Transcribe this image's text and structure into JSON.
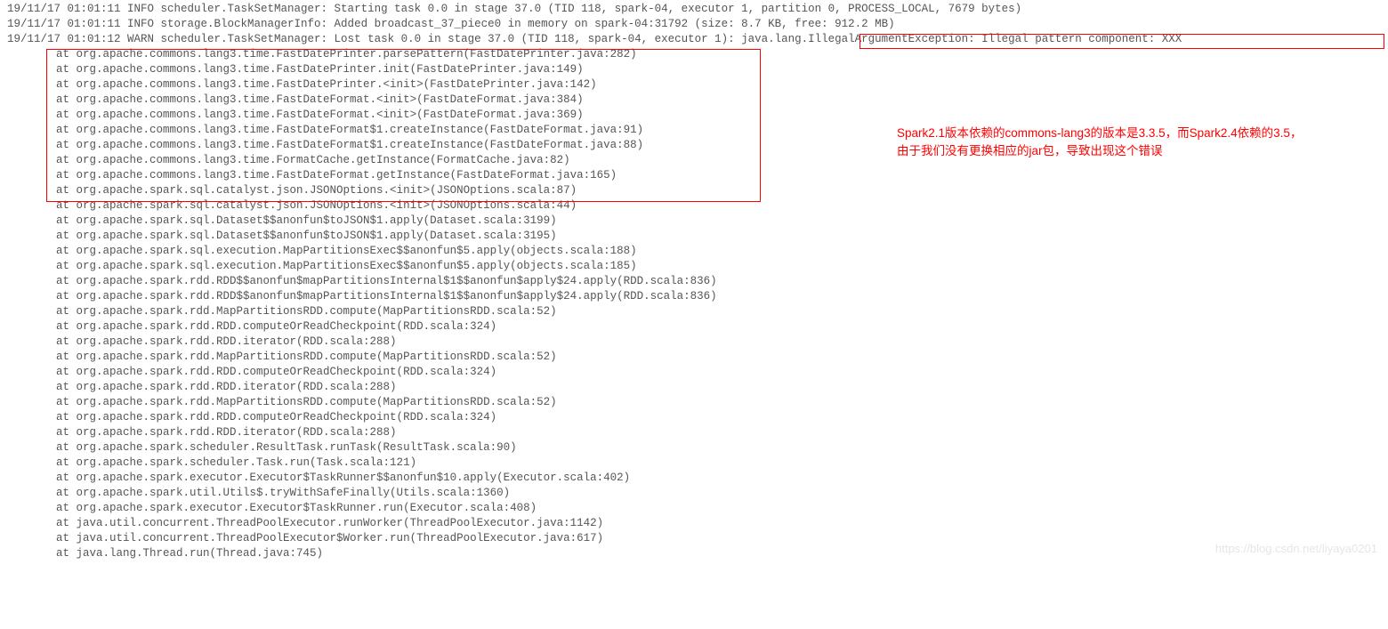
{
  "log": {
    "lines": [
      "19/11/17 01:01:11 INFO scheduler.TaskSetManager: Starting task 0.0 in stage 37.0 (TID 118, spark-04, executor 1, partition 0, PROCESS_LOCAL, 7679 bytes)",
      "19/11/17 01:01:11 INFO storage.BlockManagerInfo: Added broadcast_37_piece0 in memory on spark-04:31792 (size: 8.7 KB, free: 912.2 MB)",
      "19/11/17 01:01:12 WARN scheduler.TaskSetManager: Lost task 0.0 in stage 37.0 (TID 118, spark-04, executor 1): java.lang.IllegalArgumentException: Illegal pattern component: XXX"
    ]
  },
  "trace": {
    "lines": [
      "at org.apache.commons.lang3.time.FastDatePrinter.parsePattern(FastDatePrinter.java:282)",
      "at org.apache.commons.lang3.time.FastDatePrinter.init(FastDatePrinter.java:149)",
      "at org.apache.commons.lang3.time.FastDatePrinter.<init>(FastDatePrinter.java:142)",
      "at org.apache.commons.lang3.time.FastDateFormat.<init>(FastDateFormat.java:384)",
      "at org.apache.commons.lang3.time.FastDateFormat.<init>(FastDateFormat.java:369)",
      "at org.apache.commons.lang3.time.FastDateFormat$1.createInstance(FastDateFormat.java:91)",
      "at org.apache.commons.lang3.time.FastDateFormat$1.createInstance(FastDateFormat.java:88)",
      "at org.apache.commons.lang3.time.FormatCache.getInstance(FormatCache.java:82)",
      "at org.apache.commons.lang3.time.FastDateFormat.getInstance(FastDateFormat.java:165)",
      "at org.apache.spark.sql.catalyst.json.JSONOptions.<init>(JSONOptions.scala:87)",
      "at org.apache.spark.sql.catalyst.json.JSONOptions.<init>(JSONOptions.scala:44)",
      "at org.apache.spark.sql.Dataset$$anonfun$toJSON$1.apply(Dataset.scala:3199)",
      "at org.apache.spark.sql.Dataset$$anonfun$toJSON$1.apply(Dataset.scala:3195)",
      "at org.apache.spark.sql.execution.MapPartitionsExec$$anonfun$5.apply(objects.scala:188)",
      "at org.apache.spark.sql.execution.MapPartitionsExec$$anonfun$5.apply(objects.scala:185)",
      "at org.apache.spark.rdd.RDD$$anonfun$mapPartitionsInternal$1$$anonfun$apply$24.apply(RDD.scala:836)",
      "at org.apache.spark.rdd.RDD$$anonfun$mapPartitionsInternal$1$$anonfun$apply$24.apply(RDD.scala:836)",
      "at org.apache.spark.rdd.MapPartitionsRDD.compute(MapPartitionsRDD.scala:52)",
      "at org.apache.spark.rdd.RDD.computeOrReadCheckpoint(RDD.scala:324)",
      "at org.apache.spark.rdd.RDD.iterator(RDD.scala:288)",
      "at org.apache.spark.rdd.MapPartitionsRDD.compute(MapPartitionsRDD.scala:52)",
      "at org.apache.spark.rdd.RDD.computeOrReadCheckpoint(RDD.scala:324)",
      "at org.apache.spark.rdd.RDD.iterator(RDD.scala:288)",
      "at org.apache.spark.rdd.MapPartitionsRDD.compute(MapPartitionsRDD.scala:52)",
      "at org.apache.spark.rdd.RDD.computeOrReadCheckpoint(RDD.scala:324)",
      "at org.apache.spark.rdd.RDD.iterator(RDD.scala:288)",
      "at org.apache.spark.scheduler.ResultTask.runTask(ResultTask.scala:90)",
      "at org.apache.spark.scheduler.Task.run(Task.scala:121)",
      "at org.apache.spark.executor.Executor$TaskRunner$$anonfun$10.apply(Executor.scala:402)",
      "at org.apache.spark.util.Utils$.tryWithSafeFinally(Utils.scala:1360)",
      "at org.apache.spark.executor.Executor$TaskRunner.run(Executor.scala:408)",
      "at java.util.concurrent.ThreadPoolExecutor.runWorker(ThreadPoolExecutor.java:1142)",
      "at java.util.concurrent.ThreadPoolExecutor$Worker.run(ThreadPoolExecutor.java:617)",
      "at java.lang.Thread.run(Thread.java:745)"
    ]
  },
  "annotation": {
    "line1": "Spark2.1版本依赖的commons-lang3的版本是3.3.5，而Spark2.4依赖的3.5，",
    "line2": "由于我们没有更换相应的jar包，导致出现这个错误"
  },
  "watermark": "https://blog.csdn.net/liyaya0201"
}
